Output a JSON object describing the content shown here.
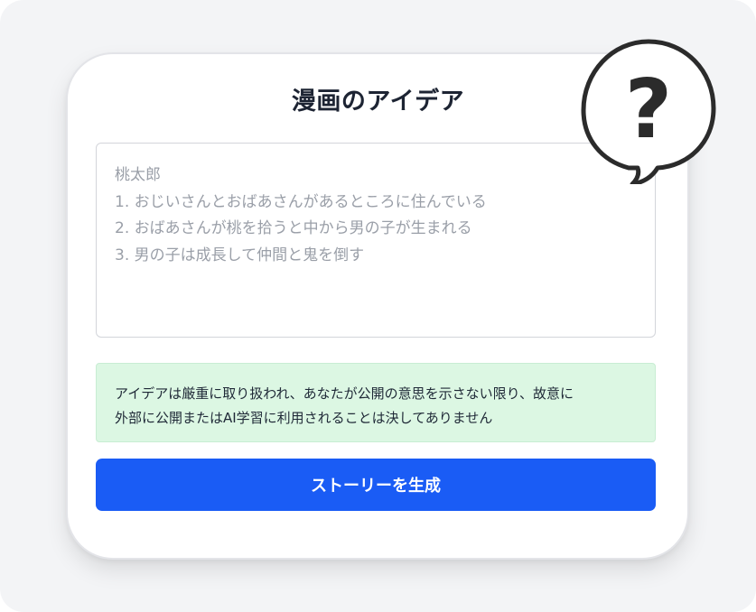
{
  "app": {
    "title": "漫画のアイデア"
  },
  "idea_input": {
    "lines": [
      "桃太郎",
      "1. おじいさんとおばあさんがあるところに住んでいる",
      "2. おばあさんが桃を拾うと中から男の子が生まれる",
      "3. 男の子は成長して仲間と鬼を倒す"
    ]
  },
  "notice": {
    "lines": [
      "アイデアは厳重に取り扱われ、あなたが公開の意思を示さない限り、故意に",
      "外部に公開またはAI学習に利用されることは決してありません"
    ]
  },
  "actions": {
    "generate_label": "ストーリーを生成"
  },
  "decoration": {
    "bubble_symbol": "?",
    "icon": "question-speech-bubble-icon"
  },
  "colors": {
    "primary_button": "#1a5cf5",
    "notice_background": "#dcf7e3",
    "placeholder_text": "#9a9fa8",
    "title_text": "#1d2433"
  }
}
